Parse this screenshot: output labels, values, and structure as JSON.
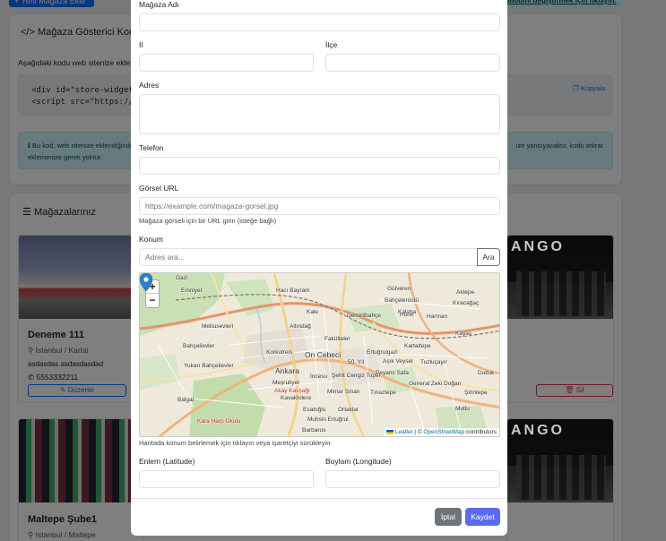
{
  "background": {
    "add_store_button": "+ Yeni Mağaza Ekle",
    "top_right_link": "adobini değiştirmek için tıklayın.",
    "embed_card": {
      "title": "Mağaza Gösterici Kodu",
      "description": "Aşağıdaki kodu web sitenize ekley",
      "code_line_1": "<div id=\"store-widget\"",
      "code_line_2": "<script src=\"https://b",
      "copy_label": "Kopyala",
      "info_left": "Bu kod, web sitenize eklendiğinde",
      "info_left_2": "eklemenize gerek yoktur.",
      "info_right": "ize yansıyacaktır, kodu tekrar"
    },
    "stores_card": {
      "title": "Mağazalarınız",
      "brand_text": "ANGO",
      "stores": [
        {
          "name": "Deneme 111",
          "location": "İstanbul / Kartal",
          "description": "asdasdas asdasdasdad",
          "phone": "5553332211",
          "edit_label": "Düzenle"
        },
        {
          "name": "Maltepe Şube1",
          "location": "İstanbul / Maltepe"
        }
      ],
      "delete_label": "Sil"
    }
  },
  "modal": {
    "fields": {
      "store_name": {
        "label": "Mağaza Adı",
        "value": ""
      },
      "province": {
        "label": "İl",
        "value": ""
      },
      "district": {
        "label": "İlçe",
        "value": ""
      },
      "address": {
        "label": "Adres",
        "value": ""
      },
      "phone": {
        "label": "Telefon",
        "value": ""
      },
      "image_url": {
        "label": "Görsel URL",
        "placeholder": "https://example.com/magaza-gorsel.jpg",
        "help": "Mağaza görseli için bir URL girin (isteğe bağlı)"
      },
      "location": {
        "label": "Konum",
        "search_placeholder": "Adres ara...",
        "search_button": "Ara"
      },
      "latitude": {
        "label": "Enlem (Latitude)",
        "value": ""
      },
      "longitude": {
        "label": "Boylam (Longitude)",
        "value": ""
      }
    },
    "map": {
      "zoom_in": "+",
      "zoom_out": "−",
      "help": "Haritada konum belirlemek için tıklayın veya işaretçiyi sürükleyin",
      "attribution_leaflet": "Leaflet",
      "attribution_sep": "|",
      "attribution_symbol": "©",
      "attribution_osm": "OpenStreetMap",
      "attribution_contributors": "contributors",
      "labels": {
        "gazi": "Gazi",
        "emniyet": "Emniyet",
        "haci_bayram": "Hacı Bayram",
        "gulveren": "Gülveren",
        "kale": "Kale",
        "bahcelerustu": "Bahçelerüstü",
        "kalaba": "Kalaba",
        "aktepe": "Aktepe",
        "demirlibahce": "Demirlibahçe",
        "hurel": "Hürel",
        "harman": "Harman",
        "kiracagac": "Kıracağaç",
        "mebusevleri": "Mebusevleri",
        "altindag": "Altındağ",
        "fakulteler": "Fakülteler",
        "kayaş": "Kayaş",
        "bahcelievler": "Bahçelievler",
        "on_cebeci": "On Cebeci",
        "ertugrulgazi": "Ertuğrulgazi",
        "kartaltepe": "Kartaltepe",
        "yukari_bahcelievler": "Yukarı Bahçelievler",
        "korkutreis": "Korkutreis",
        "ankara": "Ankara",
        "asik_veysel": "Aşık Veysel",
        "tuzlucayir": "Tuzluçayır",
        "dutluk": "Dutluk",
        "peyami_safa": "Peyami Safa",
        "sehit_cengiz": "Şehit Cengiz Topel",
        "incesu": "İncesu",
        "mesrutiyet": "Meşrutiyet",
        "general_zeki": "General Zeki Doğan",
        "sirintepe": "Şirintepe",
        "kavaklidere": "Kavaklıdere",
        "mimar_sinan": "Mimar Sinan",
        "tinaztepe": "Tınaztepe",
        "esatoglu": "Esatoğlu",
        "mutlu": "Mutlu",
        "balgat": "Balgat",
        "muhsin": "Muhsin Ertuğrul",
        "ortaklar": "Ortaklar",
        "barbaros": "Barbaros",
        "kara_harp": "Kara Harp Okulu",
        "km": "50. Yıl",
        "atakoy": "Akay Kavşağı"
      }
    },
    "footer": {
      "cancel_label": "İptal",
      "save_label": "Kaydet"
    }
  }
}
